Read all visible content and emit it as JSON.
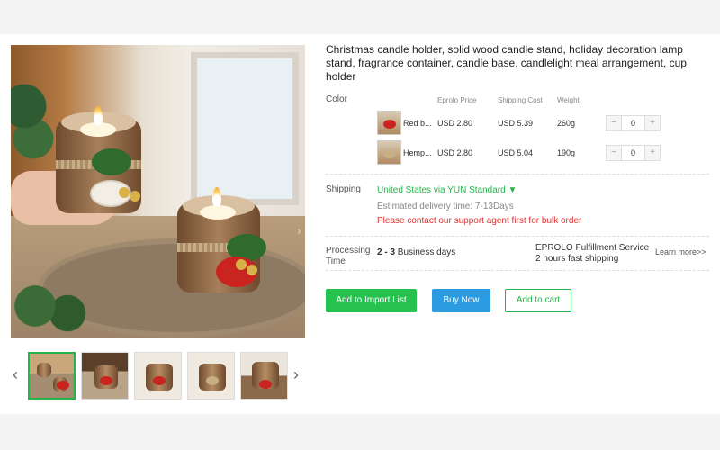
{
  "product": {
    "title": "Christmas candle holder, solid wood candle stand, holiday decoration lamp stand, fragrance container, candle base, candlelight meal arrangement, cup holder"
  },
  "gallery": {
    "thumbnail_count": 5,
    "active_index": 0
  },
  "variants_table": {
    "color_label": "Color",
    "headers": {
      "price": "Eprolo Price",
      "shipping": "Shipping Cost",
      "weight": "Weight"
    },
    "rows": [
      {
        "name": "Red b...",
        "price": "USD 2.80",
        "shipping": "USD 5.39",
        "weight": "260g",
        "quantity": "0"
      },
      {
        "name": "Hemp...",
        "price": "USD 2.80",
        "shipping": "USD 5.04",
        "weight": "190g",
        "quantity": "0"
      }
    ],
    "minus": "−",
    "plus": "+"
  },
  "shipping": {
    "label": "Shipping",
    "method": "United States via YUN Standard ▼",
    "estimated": "Estimated delivery time: 7-13Days",
    "bulk_notice": "Please contact our support agent first for bulk order"
  },
  "processing": {
    "label_line1": "Processing",
    "label_line2": "Time",
    "days_bold": "2 - 3",
    "days_suffix": " Business days",
    "service_line1": "EPROLO Fulfillment Service",
    "service_line2": "2 hours fast shipping",
    "learn_more": "Learn more>>"
  },
  "actions": {
    "import": "Add to Import List",
    "buy": "Buy Now",
    "cart": "Add to cart"
  },
  "colors": {
    "green": "#25b44a",
    "blue": "#2a9be0",
    "red_notice": "#e03030"
  }
}
